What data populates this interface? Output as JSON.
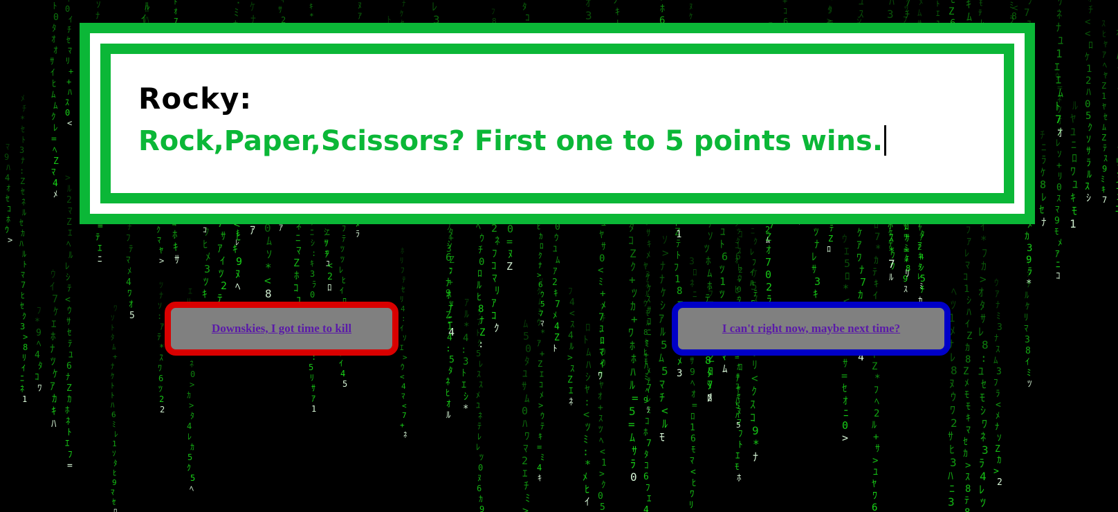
{
  "dialog": {
    "speaker": "Rocky:",
    "message": "Rock,Paper,Scissors? First one to 5 points wins."
  },
  "choices": {
    "accept_label": "Downskies, I got time to kill",
    "decline_label": "I can't right now, maybe next time?"
  },
  "colors": {
    "background": "#000000",
    "rain_green": "#19e319",
    "dialog_green": "#0bb737",
    "dialog_white": "#ffffff",
    "speaker_text": "#000000",
    "message_text": "#0bb737",
    "button_fill": "#808080",
    "accept_border": "#d90000",
    "decline_border": "#0000c8",
    "link_text": "#5a1aa8"
  },
  "icons": {
    "background": "matrix-code-rain",
    "text_cursor": "typing-caret"
  }
}
